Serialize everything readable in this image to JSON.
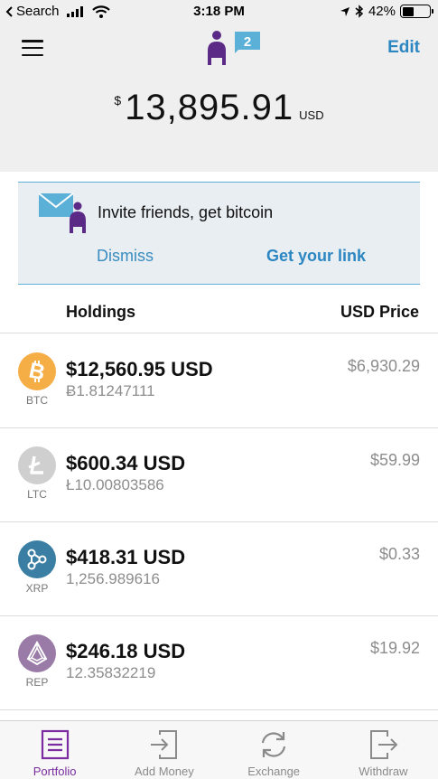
{
  "status_bar": {
    "back_label": "Search",
    "time": "3:18 PM",
    "battery": "42%",
    "battery_level": 0.42
  },
  "navbar": {
    "notification_count": "2",
    "edit_label": "Edit",
    "colors": {
      "brand": "#5b2a86",
      "accent": "#2b86c2",
      "badge": "#5bb0d8"
    }
  },
  "balance": {
    "currency_symbol": "$",
    "amount": "13,895.91",
    "unit": "USD"
  },
  "invite": {
    "title": "Invite friends, get bitcoin",
    "dismiss_label": "Dismiss",
    "link_label": "Get your link",
    "icon": "envelope-person-icon"
  },
  "holdings": {
    "header_holdings": "Holdings",
    "header_price": "USD Price",
    "items": [
      {
        "ticker": "BTC",
        "usd_value": "$12,560.95 USD",
        "amount": "Ƀ1.81247111",
        "price": "$6,930.29",
        "color": "#f5ae45",
        "icon": "bitcoin-icon"
      },
      {
        "ticker": "LTC",
        "usd_value": "$600.34 USD",
        "amount": "Ł10.00803586",
        "price": "$59.99",
        "color": "#cfcfcf",
        "icon": "litecoin-icon"
      },
      {
        "ticker": "XRP",
        "usd_value": "$418.31 USD",
        "amount": "1,256.989616",
        "price": "$0.33",
        "color": "#3a7ea3",
        "icon": "ripple-icon"
      },
      {
        "ticker": "REP",
        "usd_value": "$246.18 USD",
        "amount": "12.35832219",
        "price": "$19.92",
        "color": "#9a7aa6",
        "icon": "augur-icon"
      }
    ]
  },
  "tabbar": {
    "tabs": [
      {
        "label": "Portfolio",
        "icon": "portfolio-icon",
        "active": true
      },
      {
        "label": "Add Money",
        "icon": "add-money-icon",
        "active": false
      },
      {
        "label": "Exchange",
        "icon": "exchange-icon",
        "active": false
      },
      {
        "label": "Withdraw",
        "icon": "withdraw-icon",
        "active": false
      }
    ]
  }
}
